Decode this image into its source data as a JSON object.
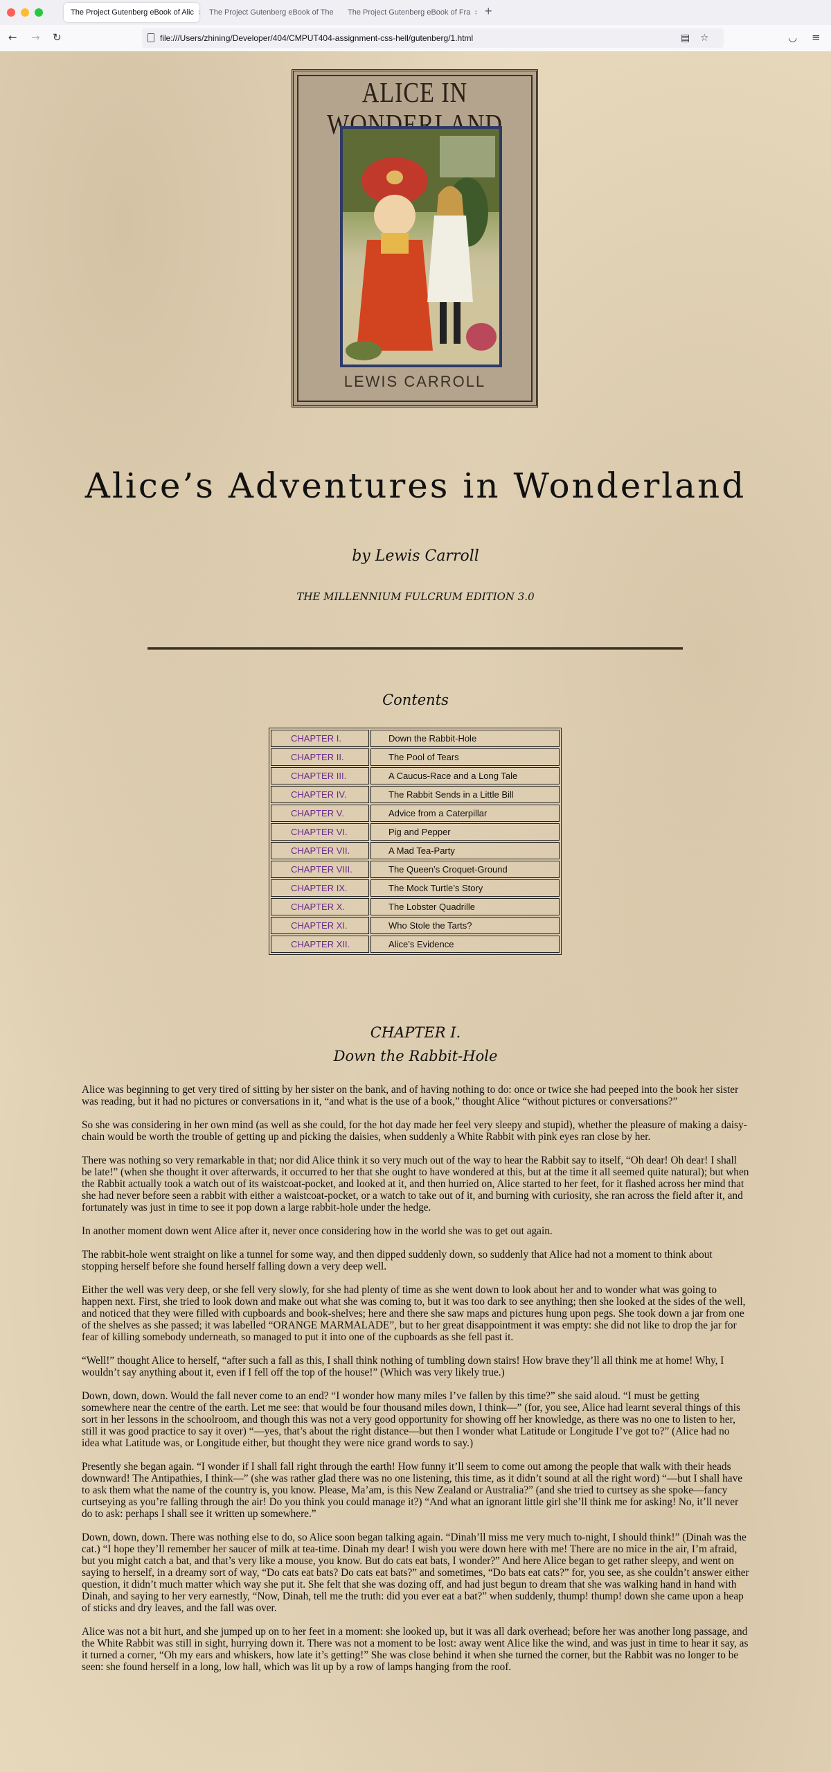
{
  "browser": {
    "tabs": [
      {
        "label": "The Project Gutenberg eBook of Alic"
      },
      {
        "label": "The Project Gutenberg eBook of The"
      },
      {
        "label": "The Project Gutenberg eBook of Fra"
      }
    ],
    "url": "file:///Users/zhining/Developer/404/CMPUT404-assignment-css-hell/gutenberg/1.html",
    "close_glyph": "×",
    "new_tab_glyph": "+"
  },
  "cover": {
    "title": "ALICE IN WONDERLAND",
    "author": "LEWIS CARROLL"
  },
  "book": {
    "title": "Alice’s Adventures in Wonderland",
    "byline": "by Lewis Carroll",
    "edition": "THE MILLENNIUM FULCRUM EDITION 3.0"
  },
  "contents": {
    "heading": "Contents",
    "chapters": [
      {
        "num": "CHAPTER I.",
        "name": "Down the Rabbit-Hole"
      },
      {
        "num": "CHAPTER II.",
        "name": "The Pool of Tears"
      },
      {
        "num": "CHAPTER III.",
        "name": "A Caucus-Race and a Long Tale"
      },
      {
        "num": "CHAPTER IV.",
        "name": "The Rabbit Sends in a Little Bill"
      },
      {
        "num": "CHAPTER V.",
        "name": "Advice from a Caterpillar"
      },
      {
        "num": "CHAPTER VI.",
        "name": "Pig and Pepper"
      },
      {
        "num": "CHAPTER VII.",
        "name": "A Mad Tea-Party"
      },
      {
        "num": "CHAPTER VIII.",
        "name": "The Queen’s Croquet-Ground"
      },
      {
        "num": "CHAPTER IX.",
        "name": "The Mock Turtle’s Story"
      },
      {
        "num": "CHAPTER X.",
        "name": "The Lobster Quadrille"
      },
      {
        "num": "CHAPTER XI.",
        "name": "Who Stole the Tarts?"
      },
      {
        "num": "CHAPTER XII.",
        "name": "Alice’s Evidence"
      }
    ]
  },
  "chapter": {
    "number": "CHAPTER I.",
    "title": "Down the Rabbit-Hole",
    "paragraphs": [
      "Alice was beginning to get very tired of sitting by her sister on the bank, and of having nothing to do: once or twice she had peeped into the book her sister was reading, but it had no pictures or conversations in it, “and what is the use of a book,” thought Alice “without pictures or conversations?”",
      "So she was considering in her own mind (as well as she could, for the hot day made her feel very sleepy and stupid), whether the pleasure of making a daisy-chain would be worth the trouble of getting up and picking the daisies, when suddenly a White Rabbit with pink eyes ran close by her.",
      "There was nothing so very remarkable in that; nor did Alice think it so very much out of the way to hear the Rabbit say to itself, “Oh dear! Oh dear! I shall be late!” (when she thought it over afterwards, it occurred to her that she ought to have wondered at this, but at the time it all seemed quite natural); but when the Rabbit actually took a watch out of its waistcoat-pocket, and looked at it, and then hurried on, Alice started to her feet, for it flashed across her mind that she had never before seen a rabbit with either a waistcoat-pocket, or a watch to take out of it, and burning with curiosity, she ran across the field after it, and fortunately was just in time to see it pop down a large rabbit-hole under the hedge.",
      "In another moment down went Alice after it, never once considering how in the world she was to get out again.",
      "The rabbit-hole went straight on like a tunnel for some way, and then dipped suddenly down, so suddenly that Alice had not a moment to think about stopping herself before she found herself falling down a very deep well.",
      "Either the well was very deep, or she fell very slowly, for she had plenty of time as she went down to look about her and to wonder what was going to happen next. First, she tried to look down and make out what she was coming to, but it was too dark to see anything; then she looked at the sides of the well, and noticed that they were filled with cupboards and book-shelves; here and there she saw maps and pictures hung upon pegs. She took down a jar from one of the shelves as she passed; it was labelled “ORANGE MARMALADE”, but to her great disappointment it was empty: she did not like to drop the jar for fear of killing somebody underneath, so managed to put it into one of the cupboards as she fell past it.",
      "“Well!” thought Alice to herself, “after such a fall as this, I shall think nothing of tumbling down stairs! How brave they’ll all think me at home! Why, I wouldn’t say anything about it, even if I fell off the top of the house!” (Which was very likely true.)",
      "Down, down, down. Would the fall never come to an end? “I wonder how many miles I’ve fallen by this time?” she said aloud. “I must be getting somewhere near the centre of the earth. Let me see: that would be four thousand miles down, I think—” (for, you see, Alice had learnt several things of this sort in her lessons in the schoolroom, and though this was not a very good opportunity for showing off her knowledge, as there was no one to listen to her, still it was good practice to say it over) “—yes, that’s about the right distance—but then I wonder what Latitude or Longitude I’ve got to?” (Alice had no idea what Latitude was, or Longitude either, but thought they were nice grand words to say.)",
      "Presently she began again. “I wonder if I shall fall right through the earth! How funny it’ll seem to come out among the people that walk with their heads downward! The Antipathies, I think—” (she was rather glad there was no one listening, this time, as it didn’t sound at all the right word) “—but I shall have to ask them what the name of the country is, you know. Please, Ma’am, is this New Zealand or Australia?” (and she tried to curtsey as she spoke—fancy curtseying as you’re falling through the air! Do you think you could manage it?) “And what an ignorant little girl she’ll think me for asking! No, it’ll never do to ask: perhaps I shall see it written up somewhere.”",
      "Down, down, down. There was nothing else to do, so Alice soon began talking again. “Dinah’ll miss me very much to-night, I should think!” (Dinah was the cat.) “I hope they’ll remember her saucer of milk at tea-time. Dinah my dear! I wish you were down here with me! There are no mice in the air, I’m afraid, but you might catch a bat, and that’s very like a mouse, you know. But do cats eat bats, I wonder?” And here Alice began to get rather sleepy, and went on saying to herself, in a dreamy sort of way, “Do cats eat bats? Do cats eat bats?” and sometimes, “Do bats eat cats?” for, you see, as she couldn’t answer either question, it didn’t much matter which way she put it. She felt that she was dozing off, and had just begun to dream that she was walking hand in hand with Dinah, and saying to her very earnestly, “Now, Dinah, tell me the truth: did you ever eat a bat?” when suddenly, thump! thump! down she came upon a heap of sticks and dry leaves, and the fall was over.",
      "Alice was not a bit hurt, and she jumped up on to her feet in a moment: she looked up, but it was all dark overhead; before her was another long passage, and the White Rabbit was still in sight, hurrying down it. There was not a moment to be lost: away went Alice like the wind, and was just in time to hear it say, as it turned a corner, “Oh my ears and whiskers, how late it’s getting!” She was close behind it when she turned the corner, but the Rabbit was no longer to be seen: she found herself in a long, low hall, which was lit up by a row of lamps hanging from the roof."
    ]
  }
}
